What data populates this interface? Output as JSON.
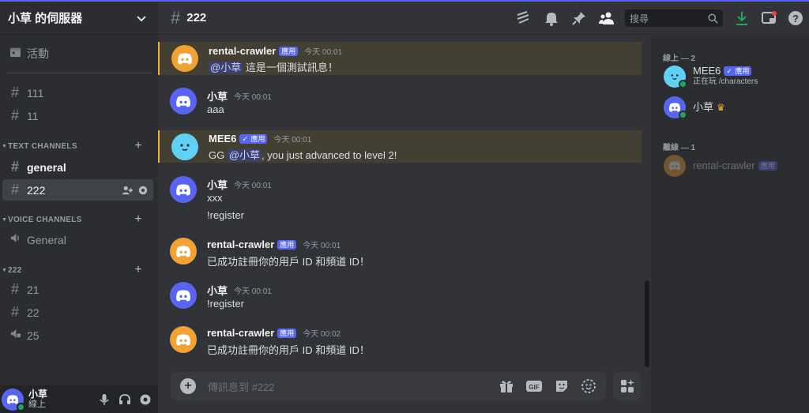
{
  "server": {
    "name": "小草 的伺服器"
  },
  "sidebar": {
    "events_label": "活動",
    "channels_top": [
      "111",
      "11"
    ],
    "categories": [
      {
        "name": "TEXT CHANNELS",
        "channels": [
          "general",
          "222"
        ]
      },
      {
        "name": "VOICE CHANNELS",
        "channels": [
          "General"
        ]
      },
      {
        "name": "222",
        "channels": [
          "21",
          "22",
          "25"
        ]
      }
    ]
  },
  "user_panel": {
    "name": "小草",
    "status": "線上"
  },
  "channel": {
    "name": "222"
  },
  "search": {
    "placeholder": "搜尋"
  },
  "messages": [
    {
      "author": "rental-crawler",
      "badge": "應用",
      "time": "今天 00:01",
      "lines": [
        "這是一個測試訊息！"
      ],
      "mention": "@小草"
    },
    {
      "author": "小草",
      "time": "今天 00:01",
      "lines": [
        "aaa"
      ]
    },
    {
      "author": "MEE6",
      "badge": "應用",
      "time": "今天 00:01",
      "text_pre": "GG ",
      "mention": "@小草",
      "text_post": ", you just advanced to level 2!"
    },
    {
      "author": "小草",
      "time": "今天 00:01",
      "lines": [
        "xxx",
        "!register"
      ]
    },
    {
      "author": "rental-crawler",
      "badge": "應用",
      "time": "今天 00:01",
      "lines": [
        "已成功註冊你的用戶 ID 和頻道 ID！"
      ]
    },
    {
      "author": "小草",
      "time": "今天 00:01",
      "lines": [
        "!register"
      ]
    },
    {
      "author": "rental-crawler",
      "badge": "應用",
      "time": "今天 00:02",
      "lines": [
        "已成功註冊你的用戶 ID 和頻道 ID！"
      ]
    }
  ],
  "composer": {
    "placeholder": "傳訊息到 #222"
  },
  "members": {
    "online_header": "線上 — 2",
    "offline_header": "離線 — 1",
    "online": [
      {
        "name": "MEE6",
        "badge": "應用",
        "activity": "正在玩 /characters"
      },
      {
        "name": "小草"
      }
    ],
    "offline": [
      {
        "name": "rental-crawler",
        "badge": "應用"
      }
    ]
  },
  "colors": {
    "accent": "#5865f2",
    "online": "#23a55a",
    "mention_bg": "#443f33",
    "mention_border": "#f0b232"
  }
}
